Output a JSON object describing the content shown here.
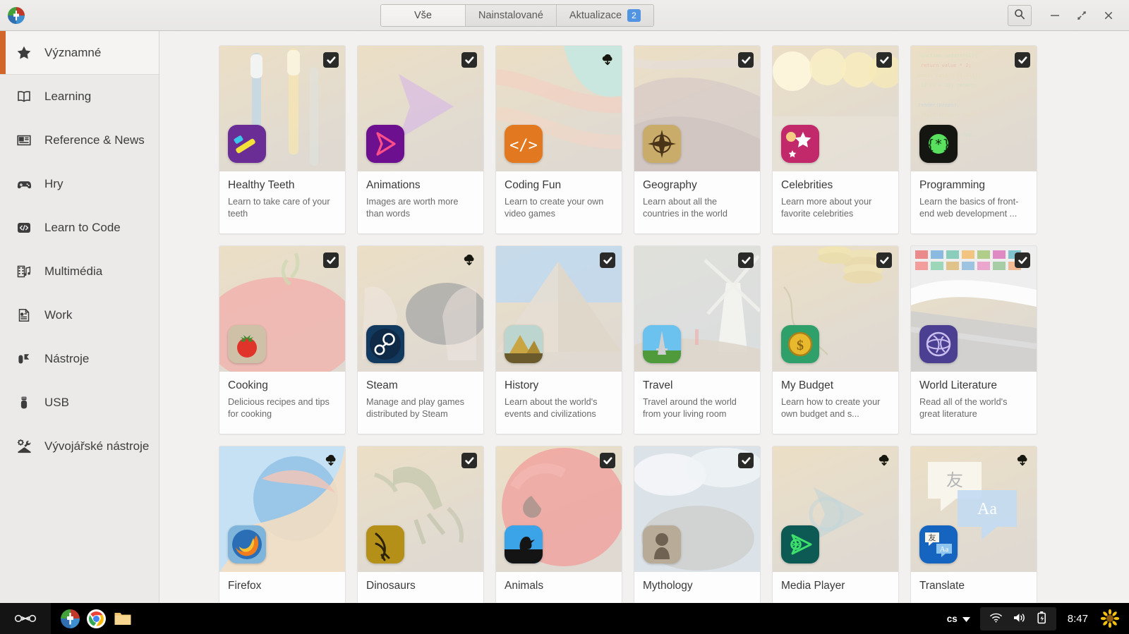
{
  "window": {
    "app_icon": "ubuntu-software-center-icon",
    "tabs": [
      {
        "label": "Vše",
        "active": true,
        "badge": null
      },
      {
        "label": "Nainstalované",
        "active": false,
        "badge": null
      },
      {
        "label": "Aktualizace",
        "active": false,
        "badge": "2"
      }
    ],
    "controls": {
      "search": "search-icon",
      "minimize": "minimize-icon",
      "restore": "restore-icon",
      "close": "close-icon"
    }
  },
  "sidebar": {
    "items": [
      {
        "label": "Významné",
        "icon": "star-icon",
        "selected": true
      },
      {
        "label": "Learning",
        "icon": "book-icon",
        "selected": false
      },
      {
        "label": "Reference & News",
        "icon": "newspaper-icon",
        "selected": false
      },
      {
        "label": "Hry",
        "icon": "gamepad-icon",
        "selected": false
      },
      {
        "label": "Learn to Code",
        "icon": "code-icon",
        "selected": false
      },
      {
        "label": "Multimédia",
        "icon": "film-music-icon",
        "selected": false
      },
      {
        "label": "Work",
        "icon": "document-icon",
        "selected": false
      },
      {
        "label": "Nástroje",
        "icon": "tools-icon",
        "selected": false
      },
      {
        "label": "USB",
        "icon": "usb-icon",
        "selected": false
      },
      {
        "label": "Vývojářské nástroje",
        "icon": "developer-tools-icon",
        "selected": false
      }
    ]
  },
  "colors": {
    "accent": "#d2652a",
    "badge_blue": "#5294e2",
    "sidebar_bg": "#ebeae8",
    "content_bg": "#f2f1f0"
  },
  "apps": [
    {
      "title": "Healthy Teeth",
      "desc": "Learn to take care of your teeth",
      "status": "installed",
      "banner": "toothbrushes-photo",
      "banner_from": "#e2cfa8",
      "banner_to": "#cfc6bb",
      "icon_bg": "#6a2d96",
      "icon_glyph": "toothbrush-icon"
    },
    {
      "title": "Animations",
      "desc": "Images are worth more than words",
      "status": "installed",
      "banner": "purple-play-arrow",
      "banner_from": "#cc9ee8",
      "banner_to": "#c79ae6",
      "icon_bg": "#6d1090",
      "icon_glyph": "play-arrow-icon"
    },
    {
      "title": "Coding Fun",
      "desc": "Learn to create your own video games",
      "status": "available",
      "banner": "peach-teal-waves",
      "banner_from": "#f8c49c",
      "banner_to": "#f6b69b",
      "icon_bg": "#e2781f",
      "icon_glyph": "code-brackets-icon"
    },
    {
      "title": "Geography",
      "desc": "Learn about all the countries in the world",
      "status": "installed",
      "banner": "sand-dunes-photo",
      "banner_from": "#cfc0bb",
      "banner_to": "#c4b6b2",
      "icon_bg": "#c9ab6a",
      "icon_glyph": "compass-icon"
    },
    {
      "title": "Celebrities",
      "desc": "Learn more about your favorite celebrities",
      "status": "installed",
      "banner": "bokeh-lights-photo",
      "banner_from": "#f1e6c4",
      "banner_to": "#d9d3c8",
      "icon_bg": "#c2296a",
      "icon_glyph": "stars-icon"
    },
    {
      "title": "Programming",
      "desc": "Learn the basics of front-end web development ...",
      "status": "installed",
      "banner": "dark-code-photo",
      "banner_from": "#4e4b47",
      "banner_to": "#3a3834",
      "icon_bg": "#151512",
      "icon_glyph": "braces-asterisk-icon"
    },
    {
      "title": "Cooking",
      "desc": "Delicious recipes and tips for cooking",
      "status": "installed",
      "banner": "tomato-photo",
      "banner_from": "#efa09c",
      "banner_to": "#e7a79d",
      "icon_bg": "#cfc0a8",
      "icon_glyph": "tomato-icon"
    },
    {
      "title": "Steam",
      "desc": "Manage and play games distributed by Steam",
      "status": "available",
      "banner": "gamepad-hands-photo",
      "banner_from": "#b9c8cc",
      "banner_to": "#a9c4d2",
      "icon_bg": "#123a5e",
      "icon_glyph": "steam-icon"
    },
    {
      "title": "History",
      "desc": "Learn about the world's events and civilizations",
      "status": "installed",
      "banner": "pyramid-photo",
      "banner_from": "#a9c8e2",
      "banner_to": "#d8cdbd",
      "icon_bg": "#c7cfae",
      "icon_glyph": "pyramids-icon"
    },
    {
      "title": "Travel",
      "desc": "Travel around the world from your living room",
      "status": "installed",
      "banner": "windmill-photo",
      "banner_from": "#b5c7d4",
      "banner_to": "#cdc4b8",
      "icon_bg": "#63b0df",
      "icon_glyph": "eiffel-tower-icon"
    },
    {
      "title": "My Budget",
      "desc": "Learn how to create your own budget and s...",
      "status": "installed",
      "banner": "coins-photo",
      "banner_from": "#efe8c2",
      "banner_to": "#e6dcb5",
      "icon_bg": "#2fa06a",
      "icon_glyph": "coin-dollar-icon"
    },
    {
      "title": "World Literature",
      "desc": "Read all of the world's great literature",
      "status": "installed",
      "banner": "open-book-flags-photo",
      "banner_from": "#dcdcdc",
      "banner_to": "#b9b9b9",
      "icon_bg": "#4a3f91",
      "icon_glyph": "globe-icon"
    },
    {
      "title": "Firefox",
      "desc": "",
      "status": "available",
      "banner": "firefox-artwork",
      "banner_from": "#a9d2ee",
      "banner_to": "#f2cfa4",
      "icon_bg": "#7fb4db",
      "icon_glyph": "firefox-icon"
    },
    {
      "title": "Dinosaurs",
      "desc": "",
      "status": "installed",
      "banner": "dinosaur-fossil-photo",
      "banner_from": "#d4d6ad",
      "banner_to": "#bfc4a4",
      "icon_bg": "#b7952a",
      "icon_glyph": "fossil-icon"
    },
    {
      "title": "Animals",
      "desc": "",
      "status": "installed",
      "banner": "parrot-photo",
      "banner_from": "#ef9a94",
      "banner_to": "#d9a8a0",
      "icon_bg": "#3ba3e8",
      "icon_glyph": "bird-icon"
    },
    {
      "title": "Mythology",
      "desc": "",
      "status": "installed",
      "banner": "clouds-statue-photo",
      "banner_from": "#cfd6dc",
      "banner_to": "#b6b6b2",
      "icon_bg": "#b3a898",
      "icon_glyph": "statue-icon"
    },
    {
      "title": "Media Player",
      "desc": "",
      "status": "available",
      "banner": "teal-media-photo",
      "banner_from": "#aec7cb",
      "banner_to": "#9fc0c6",
      "icon_bg": "#0d5a55",
      "icon_glyph": "media-play-icon"
    },
    {
      "title": "Translate",
      "desc": "",
      "status": "available",
      "banner": "translate-bubbles-artwork",
      "banner_from": "#b8c9f0",
      "banner_to": "#aec2ec",
      "icon_bg": "#1565c0",
      "icon_glyph": "translate-icon"
    }
  ],
  "taskbar": {
    "launcher_icon": "launcher-icon",
    "apps": [
      {
        "name": "software-center-icon"
      },
      {
        "name": "chrome-icon"
      },
      {
        "name": "file-manager-icon"
      }
    ],
    "language": "cs",
    "tray": [
      "wifi-icon",
      "volume-icon",
      "battery-charging-icon"
    ],
    "time": "8:47",
    "indicator": "sunflower-icon"
  }
}
